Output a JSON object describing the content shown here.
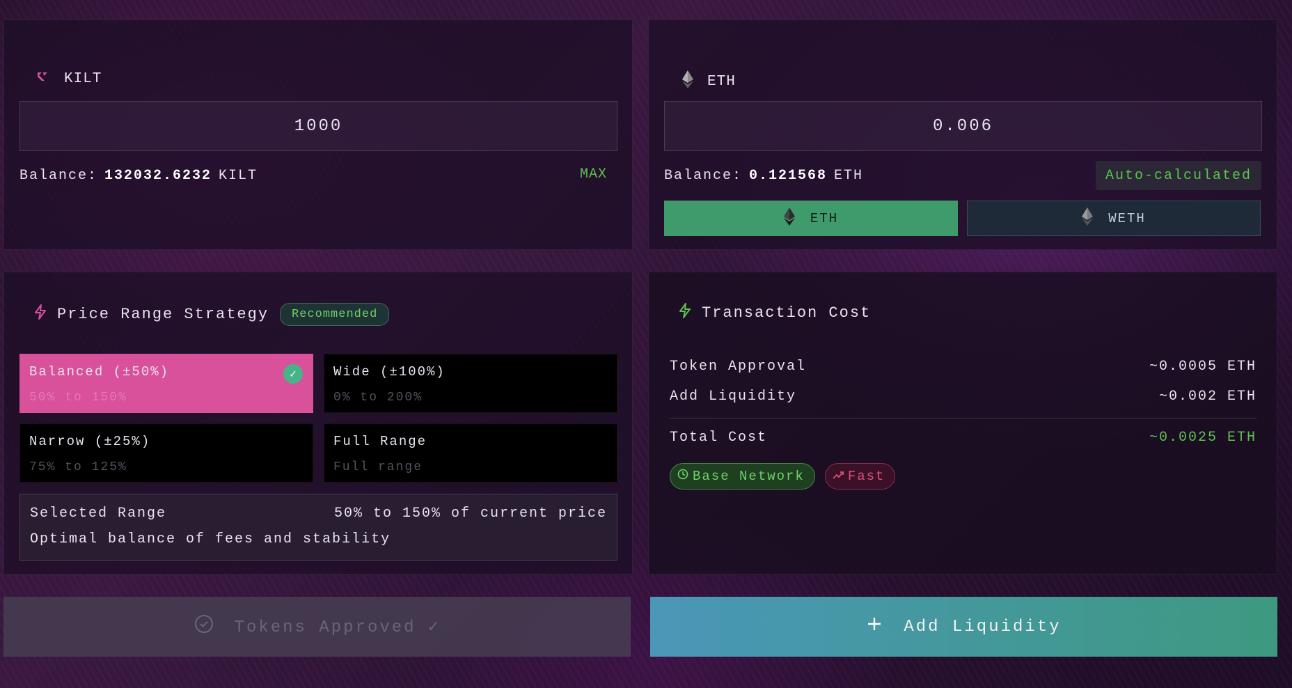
{
  "kilt_card": {
    "token": "KILT",
    "amount": "1000",
    "balance_label": "Balance:",
    "balance_value": "132032.6232",
    "balance_unit": "KILT",
    "max_label": "MAX"
  },
  "eth_card": {
    "token": "ETH",
    "amount": "0.006",
    "balance_label": "Balance:",
    "balance_value": "0.121568",
    "balance_unit": "ETH",
    "auto_label": "Auto-calculated",
    "toggle_eth": "ETH",
    "toggle_weth": "WETH"
  },
  "range_card": {
    "title": "Price Range Strategy",
    "badge": "Recommended",
    "options": [
      {
        "name": "Balanced (±50%)",
        "range": "50% to 150%"
      },
      {
        "name": "Wide (±100%)",
        "range": "0% to 200%"
      },
      {
        "name": "Narrow (±25%)",
        "range": "75% to 125%"
      },
      {
        "name": "Full Range",
        "range": "Full range"
      }
    ],
    "check": "✓",
    "selected_label": "Selected Range",
    "selected_value": "50% to 150% of current price",
    "selected_desc": "Optimal balance of fees and stability"
  },
  "cost_card": {
    "title": "Transaction Cost",
    "rows": [
      {
        "label": "Token Approval",
        "value": "~0.0005 ETH"
      },
      {
        "label": "Add Liquidity",
        "value": "~0.002 ETH"
      }
    ],
    "total_label": "Total Cost",
    "total_value": "~0.0025 ETH",
    "network_pill": "Base Network",
    "speed_pill": "Fast"
  },
  "actions": {
    "approved_label": "Tokens Approved ✓",
    "add_label": "Add Liquidity"
  },
  "colors": {
    "accent_pink": "#d8519a",
    "accent_green": "#5fc04f",
    "toggle_active": "#3f9a6c"
  }
}
